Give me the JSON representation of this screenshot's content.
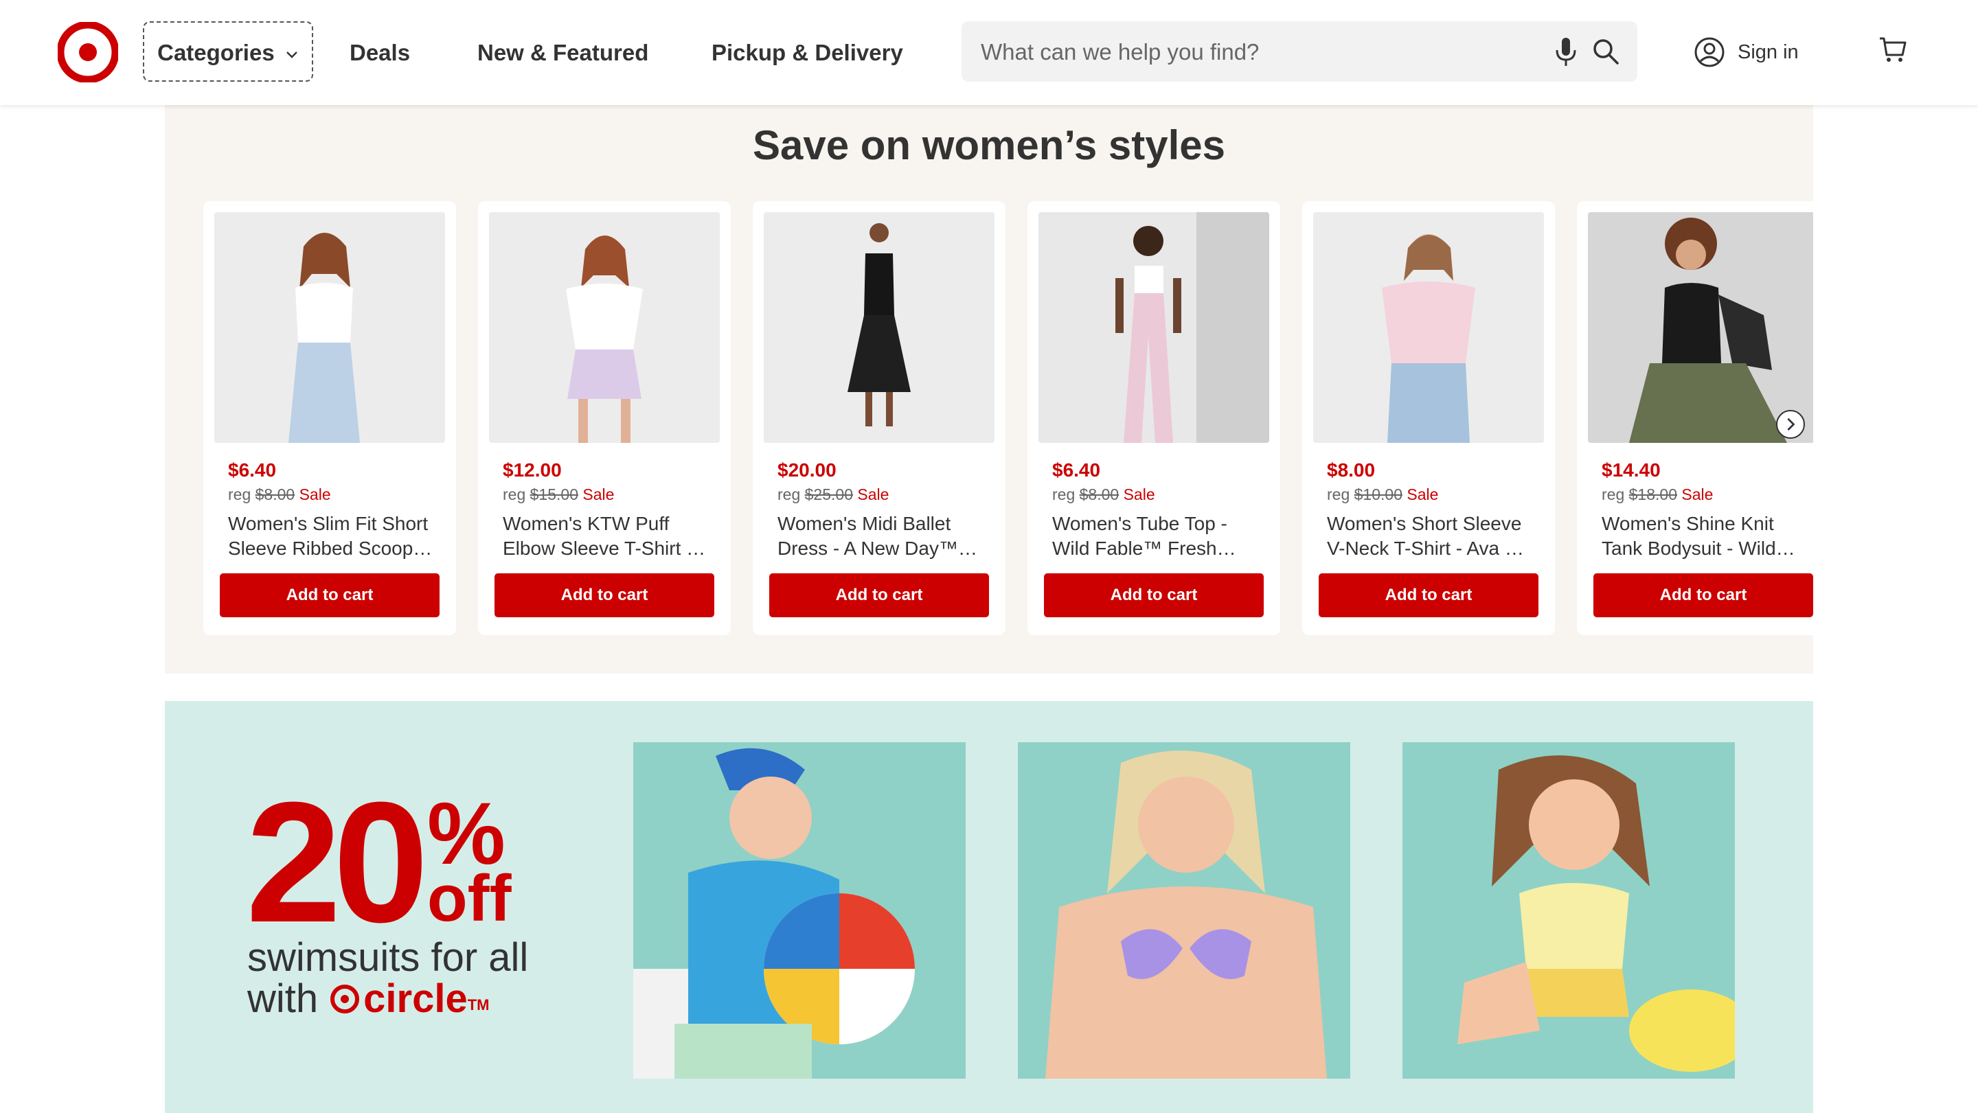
{
  "header": {
    "logo_alt": "Target",
    "nav": {
      "categories": "Categories",
      "deals": "Deals",
      "new_featured": "New & Featured",
      "pickup_delivery": "Pickup & Delivery"
    },
    "search": {
      "placeholder": "What can we help you find?",
      "value": ""
    },
    "account": {
      "sign_in": "Sign in"
    },
    "icons": [
      "target-logo-icon",
      "chevron-down-icon",
      "microphone-icon",
      "search-icon",
      "account-icon",
      "cart-icon"
    ]
  },
  "women_section": {
    "title": "Save on women’s styles",
    "products": [
      {
        "sale_price": "$6.40",
        "reg_label": "reg",
        "reg_price": "$8.00",
        "sale_label": "Sale",
        "title": "Women's Slim Fit Short Sleeve Ribbed Scoop Neck T-Shirt",
        "button": "Add to cart"
      },
      {
        "sale_price": "$12.00",
        "reg_label": "reg",
        "reg_price": "$15.00",
        "sale_label": "Sale",
        "title": "Women's KTW Puff Elbow Sleeve T-Shirt - Wild Fable",
        "button": "Add to cart"
      },
      {
        "sale_price": "$20.00",
        "reg_label": "reg",
        "reg_price": "$25.00",
        "sale_label": "Sale",
        "title": "Women's Midi Ballet Dress - A New Day™ Black",
        "button": "Add to cart"
      },
      {
        "sale_price": "$6.40",
        "reg_label": "reg",
        "reg_price": "$8.00",
        "sale_label": "Sale",
        "title": "Women's Tube Top - Wild Fable™ Fresh White",
        "button": "Add to cart"
      },
      {
        "sale_price": "$8.00",
        "reg_label": "reg",
        "reg_price": "$10.00",
        "sale_label": "Sale",
        "title": "Women's Short Sleeve V-Neck T-Shirt - Ava & Viv",
        "button": "Add to cart"
      },
      {
        "sale_price": "$14.40",
        "reg_label": "reg",
        "reg_price": "$18.00",
        "sale_label": "Sale",
        "title": "Women's Shine Knit Tank Bodysuit - Wild Fable",
        "button": "Add to cart"
      }
    ]
  },
  "swim_promo": {
    "number": "20",
    "percent": "%",
    "off": "off",
    "line1": "swimsuits for all",
    "line2_prefix": "with",
    "brand": "circle",
    "trademark": "TM"
  },
  "colors": {
    "brand_red": "#cc0000",
    "section_bg": "#f8f4ef",
    "promo_bg": "#d5ede9",
    "text": "#333333"
  }
}
